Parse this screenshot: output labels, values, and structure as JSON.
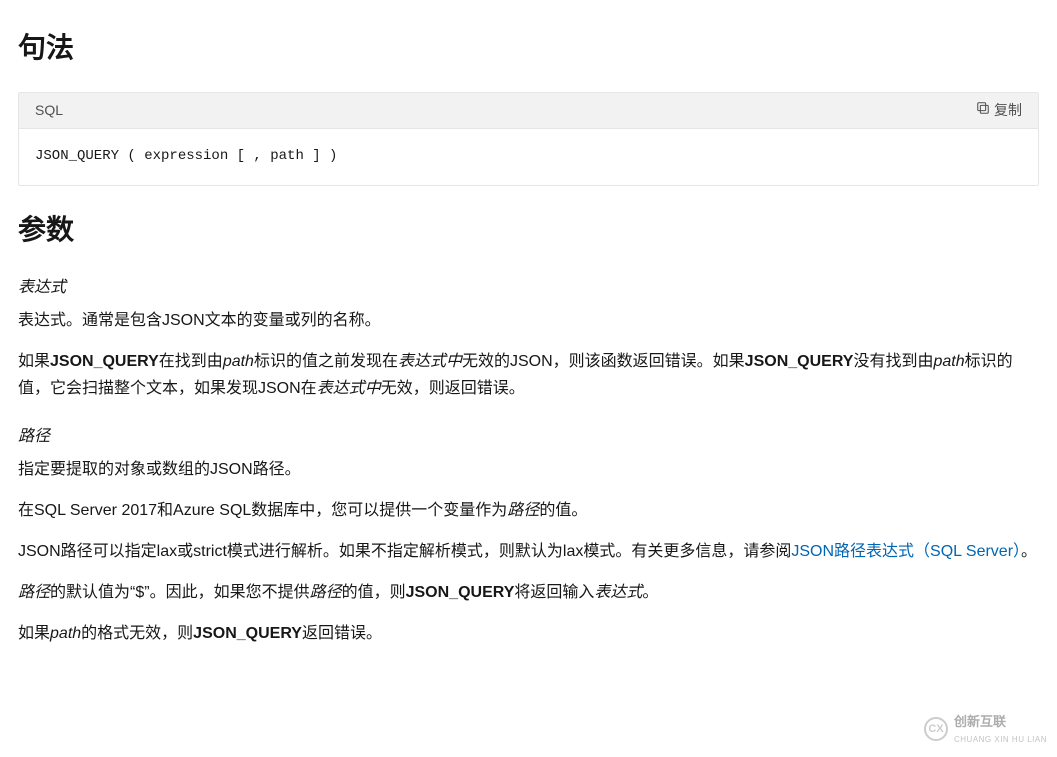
{
  "syntax": {
    "heading": "句法",
    "code_lang": "SQL",
    "copy_label": "复制",
    "code": "JSON_QUERY ( expression [ , path ] )"
  },
  "params": {
    "heading": "参数",
    "expr_label": "表达式",
    "expr_desc": "表达式。通常是包含JSON文本的变量或列的名称。",
    "expr_para2": {
      "t1": "如果",
      "bold1": "JSON_QUERY",
      "t2": "在找到由",
      "ital1": "path",
      "t3": "标识的值之前发现在",
      "ital2": "表达式中",
      "t4": "无效的JSON，则该函数返回错误。如果",
      "bold2": "JSON_QUERY",
      "t5": "没有找到由",
      "ital3": "path",
      "t6": "标识的值，它会扫描整个文本，如果发现JSON在",
      "ital4": "表达式中",
      "t7": "无效，则返回错误。"
    },
    "path_label": "路径",
    "path_desc": "指定要提取的对象或数组的JSON路径。",
    "path_para2": {
      "t1": "在SQL Server 2017和Azure SQL数据库中，您可以提供一个变量作为",
      "ital1": "路径",
      "t2": "的值。"
    },
    "path_para3": {
      "t1": "JSON路径可以指定lax或strict模式进行解析。如果不指定解析模式，则默认为lax模式。有关更多信息，请参阅",
      "link_text": "JSON路径表达式（SQL Server）",
      "t2": "。"
    },
    "path_para4": {
      "ital1": "路径",
      "t1": "的默认值为“$”。因此，如果您不提供",
      "ital2": "路径",
      "t2": "的值，则",
      "bold1": "JSON_QUERY",
      "t3": "将返回输入",
      "ital3": "表达式",
      "t4": "。"
    },
    "path_para5": {
      "t1": "如果",
      "ital1": "path",
      "t2": "的格式无效，则",
      "bold1": "JSON_QUERY",
      "t3": "返回错误。"
    }
  },
  "watermark": {
    "brand_zh": "创新互联",
    "brand_en": "CHUANG XIN HU LIAN",
    "logo_letter": "CX"
  }
}
